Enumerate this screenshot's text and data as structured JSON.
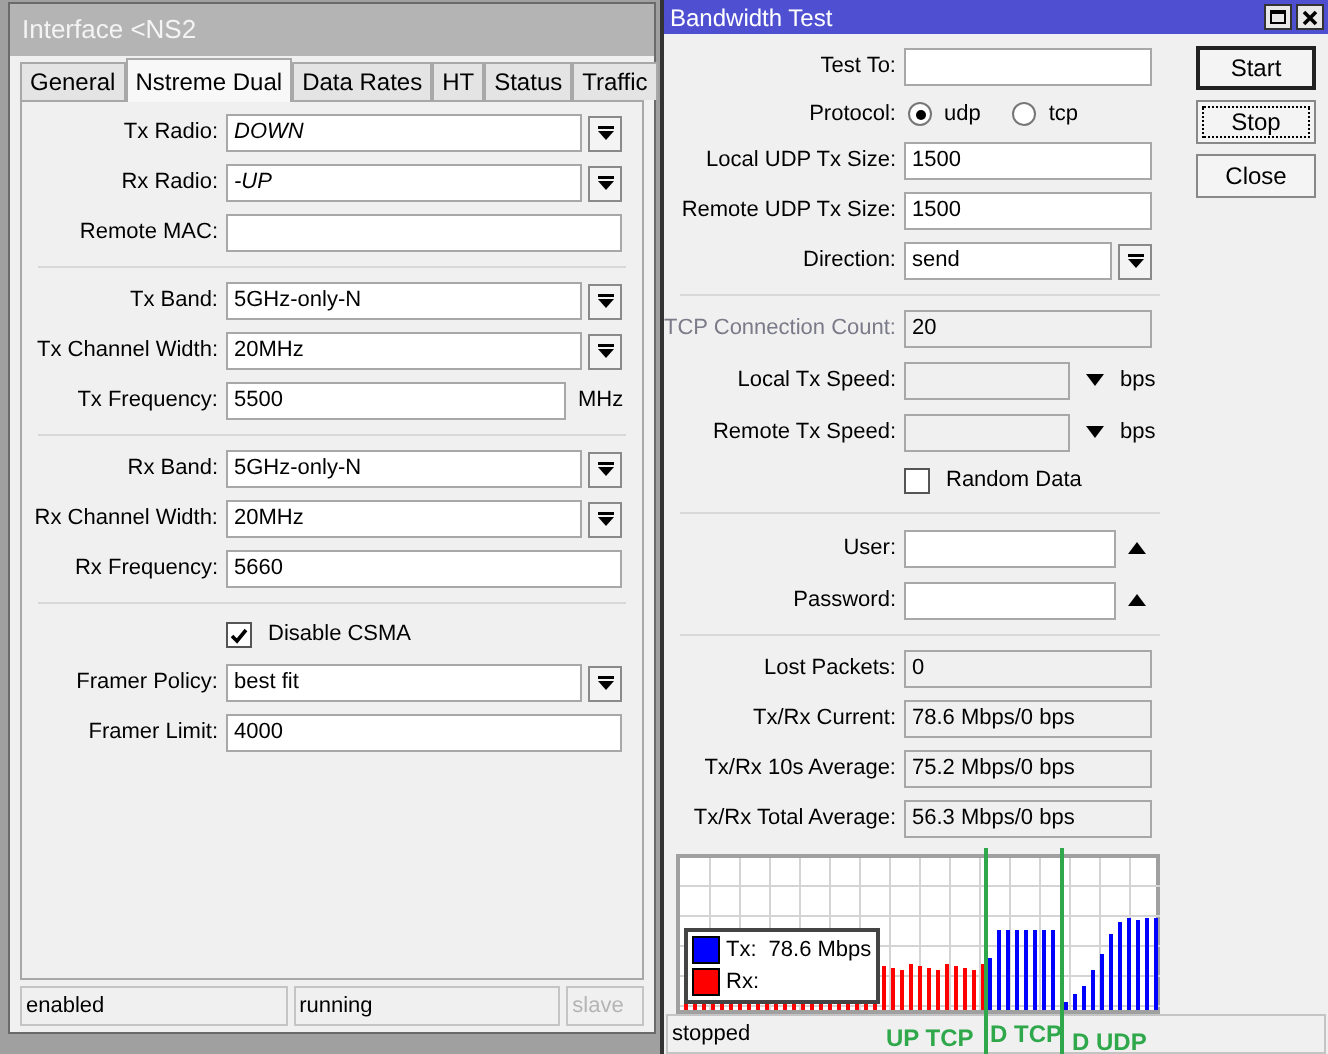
{
  "interface_window": {
    "title": "Interface <NS2",
    "tabs": [
      {
        "label": "General",
        "selected": false
      },
      {
        "label": "Nstreme Dual",
        "selected": true
      },
      {
        "label": "Data Rates",
        "selected": false
      },
      {
        "label": "HT",
        "selected": false
      },
      {
        "label": "Status",
        "selected": false
      },
      {
        "label": "Traffic",
        "selected": false
      }
    ],
    "fields": [
      {
        "kind": "dropdown",
        "label": "Tx Radio:",
        "value": "DOWN",
        "italic": true
      },
      {
        "kind": "dropdown",
        "label": "Rx Radio:",
        "value": "-UP",
        "italic": true
      },
      {
        "kind": "text",
        "label": "Remote MAC:"
      },
      {
        "kind": "divider"
      },
      {
        "kind": "dropdown",
        "label": "Tx Band:",
        "value": "5GHz-only-N"
      },
      {
        "kind": "dropdown",
        "label": "Tx Channel Width:",
        "value": "20MHz"
      },
      {
        "kind": "unit",
        "label": "Tx Frequency:",
        "value": "5500",
        "unit": "MHz"
      },
      {
        "kind": "divider"
      },
      {
        "kind": "dropdown",
        "label": "Rx Band:",
        "value": "5GHz-only-N"
      },
      {
        "kind": "dropdown",
        "label": "Rx Channel Width:",
        "value": "20MHz"
      },
      {
        "kind": "text",
        "label": "Rx Frequency:",
        "value": "5660"
      },
      {
        "kind": "divider"
      },
      {
        "kind": "checkbox",
        "label": "Disable CSMA",
        "checked": true
      },
      {
        "kind": "dropdown",
        "label": "Framer Policy:",
        "value": "best fit"
      },
      {
        "kind": "text",
        "label": "Framer Limit:",
        "value": "4000"
      }
    ],
    "status_bar": [
      {
        "text": "enabled",
        "disabled": false
      },
      {
        "text": "running",
        "disabled": false
      },
      {
        "text": "slave",
        "disabled": true
      }
    ]
  },
  "bandwidth_window": {
    "title": "Bandwidth Test",
    "buttons": [
      {
        "label": "Start",
        "kind": "default"
      },
      {
        "label": "Stop",
        "kind": "focused"
      },
      {
        "label": "Close",
        "kind": "normal"
      }
    ],
    "fields": [
      {
        "kind": "text",
        "label": "Test To:"
      },
      {
        "kind": "radio",
        "label": "Protocol:",
        "options": [
          {
            "label": "udp",
            "selected": true
          },
          {
            "label": "tcp",
            "selected": false
          }
        ]
      },
      {
        "kind": "text",
        "label": "Local UDP Tx Size:",
        "value": "1500"
      },
      {
        "kind": "text",
        "label": "Remote UDP Tx Size:",
        "value": "1500"
      },
      {
        "kind": "dropdown",
        "label": "Direction:",
        "value": "send"
      },
      {
        "kind": "divider"
      },
      {
        "kind": "readonly",
        "label": "TCP Connection Count:",
        "value": "20",
        "disabled": true
      },
      {
        "kind": "speed",
        "label": "Local Tx Speed:",
        "unit": "bps"
      },
      {
        "kind": "speed",
        "label": "Remote Tx Speed:",
        "unit": "bps"
      },
      {
        "kind": "checkbox",
        "label": "Random Data",
        "checked": false
      },
      {
        "kind": "divider"
      },
      {
        "kind": "login",
        "label": "User:"
      },
      {
        "kind": "login",
        "label": "Password:"
      },
      {
        "kind": "divider"
      },
      {
        "kind": "readonly",
        "label": "Lost Packets:",
        "value": "0"
      },
      {
        "kind": "readonly",
        "label": "Tx/Rx Current:",
        "value": "78.6 Mbps/0 bps"
      },
      {
        "kind": "readonly",
        "label": "Tx/Rx 10s Average:",
        "value": "75.2 Mbps/0 bps"
      },
      {
        "kind": "readonly",
        "label": "Tx/Rx Total Average:",
        "value": "56.3 Mbps/0 bps"
      }
    ],
    "legend": [
      {
        "label": "Tx:",
        "value": "78.6 Mbps",
        "color": "#0000ff"
      },
      {
        "label": "Rx:",
        "color": "#ff0000"
      }
    ],
    "status": "stopped",
    "annotations": [
      "UP TCP",
      "D TCP",
      "D UDP"
    ]
  }
}
